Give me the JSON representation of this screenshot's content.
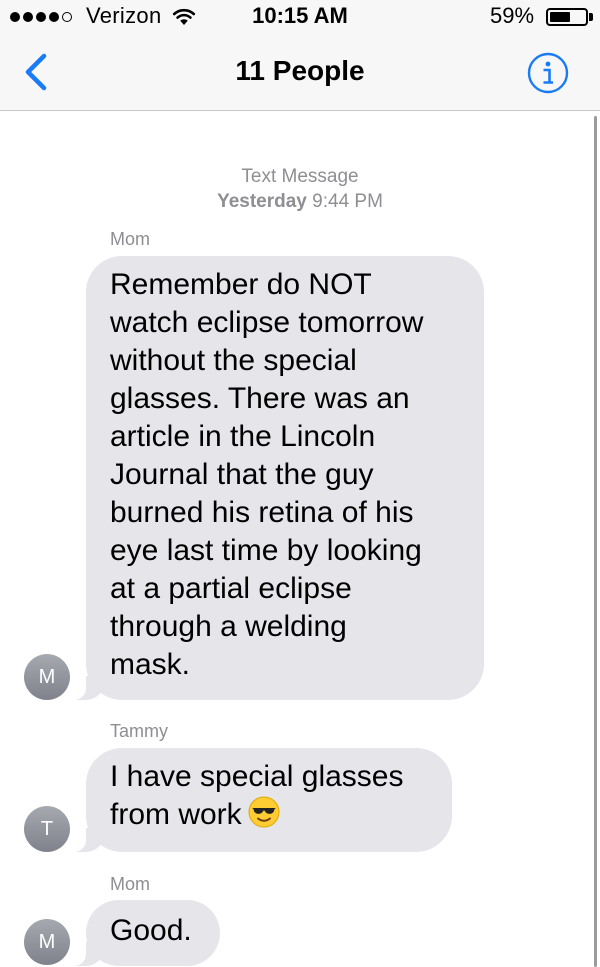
{
  "status_bar": {
    "carrier": "Verizon",
    "time": "10:15 AM",
    "battery_percent": "59%",
    "battery_level": 0.59,
    "signal_bars_filled": 4,
    "signal_bars_total": 5
  },
  "nav": {
    "title": "11 People",
    "back_icon": "chevron-left-icon",
    "info_icon": "info-icon",
    "accent_color": "#1a7cf5"
  },
  "conversation": {
    "header_label": "Text Message",
    "date": "Yesterday",
    "time": "9:44 PM"
  },
  "messages": [
    {
      "sender": "Mom",
      "avatar_initial": "M",
      "text": "Remember do NOT\nwatch eclipse tomorrow\nwithout the special\nglasses. There was an\narticle in the Lincoln\nJournal that the guy\nburned his retina of his\neye last time by looking\nat a partial eclipse\nthrough a welding\nmask."
    },
    {
      "sender": "Tammy",
      "avatar_initial": "T",
      "text": "I have special glasses\nfrom work",
      "emoji": "sunglasses-face-emoji"
    },
    {
      "sender": "Mom",
      "avatar_initial": "M",
      "text": "Good."
    }
  ],
  "colors": {
    "incoming_bubble": "#e5e5ea",
    "meta_text": "#8e8e93",
    "bar_background": "#f7f7f7"
  }
}
